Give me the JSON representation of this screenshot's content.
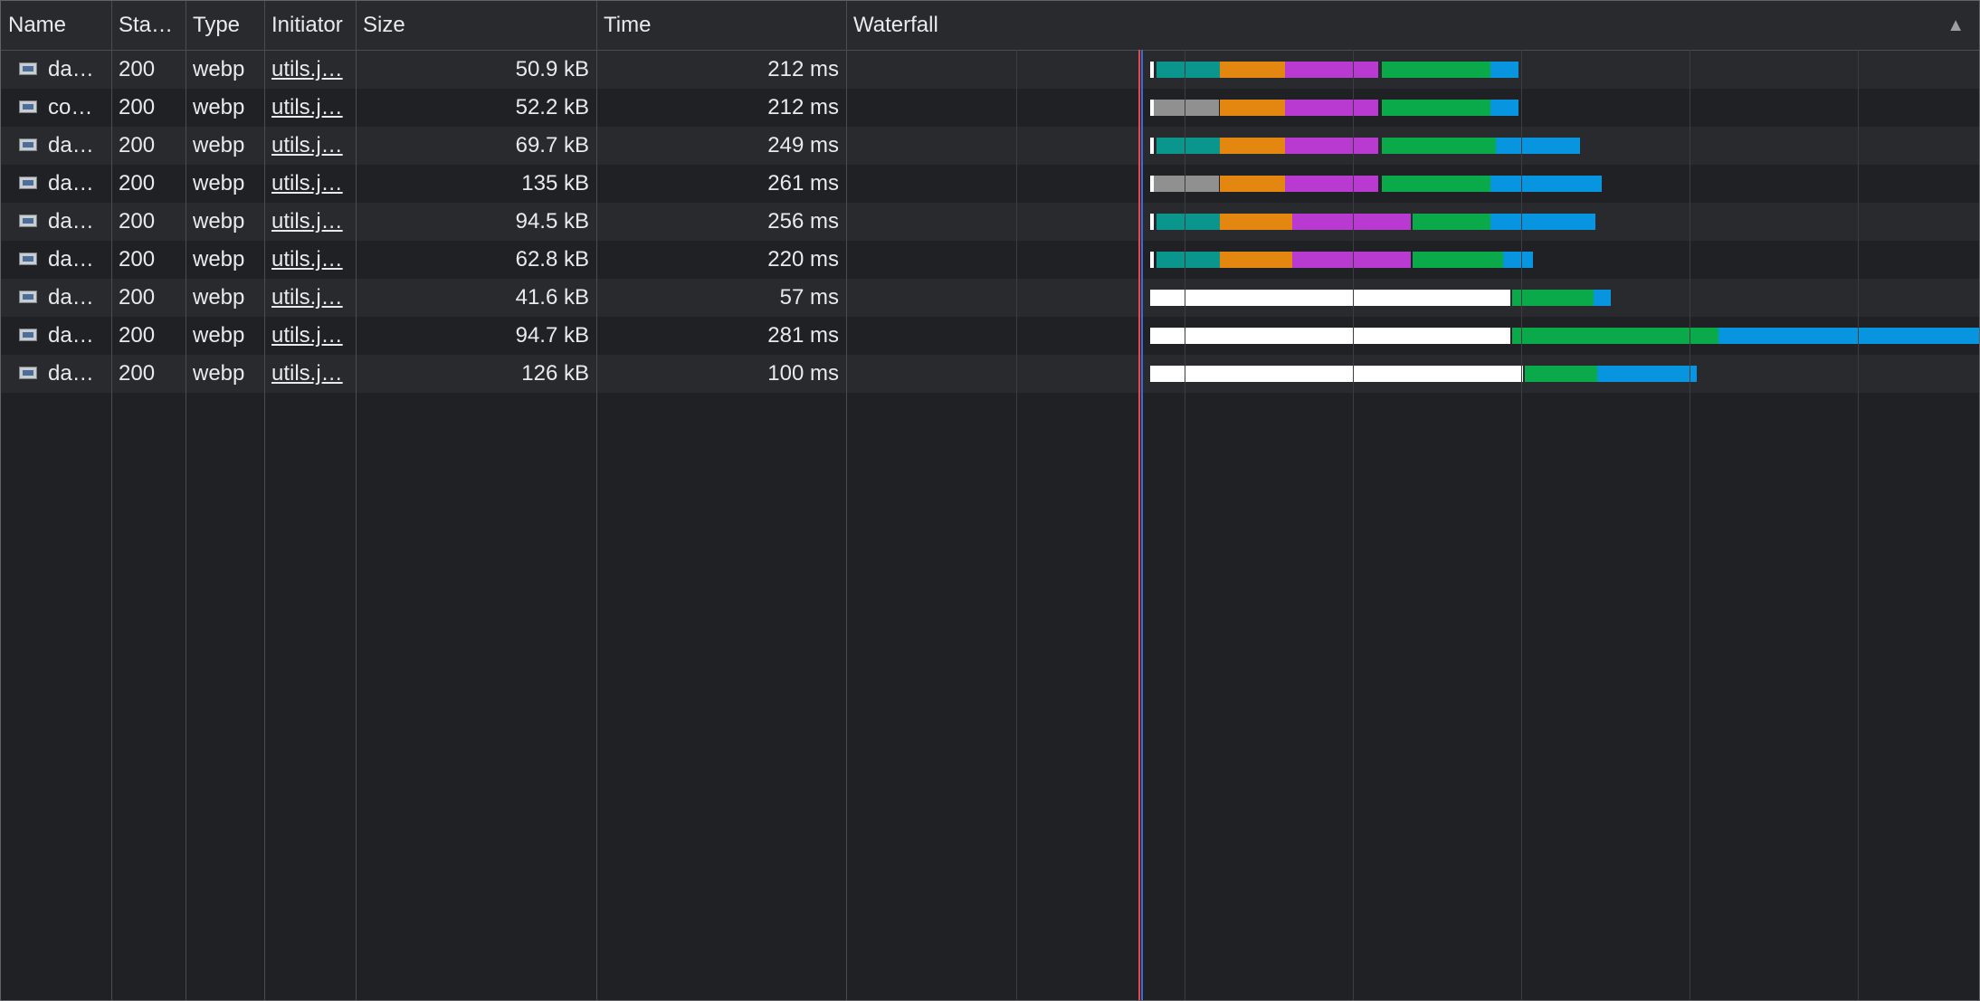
{
  "columns": {
    "name": "Name",
    "status": "Sta…",
    "type": "Type",
    "initiator": "Initiator",
    "size": "Size",
    "time": "Time",
    "waterfall": "Waterfall",
    "sort_icon": "triangle-up-icon"
  },
  "rows": [
    {
      "name": "da…",
      "status": "200",
      "type": "webp",
      "initiator": "utils.j…",
      "size": "50.9 kB",
      "time": "212 ms"
    },
    {
      "name": "co…",
      "status": "200",
      "type": "webp",
      "initiator": "utils.j…",
      "size": "52.2 kB",
      "time": "212 ms"
    },
    {
      "name": "da…",
      "status": "200",
      "type": "webp",
      "initiator": "utils.j…",
      "size": "69.7 kB",
      "time": "249 ms"
    },
    {
      "name": "da…",
      "status": "200",
      "type": "webp",
      "initiator": "utils.j…",
      "size": "135 kB",
      "time": "261 ms"
    },
    {
      "name": "da…",
      "status": "200",
      "type": "webp",
      "initiator": "utils.j…",
      "size": "94.5 kB",
      "time": "256 ms"
    },
    {
      "name": "da…",
      "status": "200",
      "type": "webp",
      "initiator": "utils.j…",
      "size": "62.8 kB",
      "time": "220 ms"
    },
    {
      "name": "da…",
      "status": "200",
      "type": "webp",
      "initiator": "utils.j…",
      "size": "41.6 kB",
      "time": "57 ms"
    },
    {
      "name": "da…",
      "status": "200",
      "type": "webp",
      "initiator": "utils.j…",
      "size": "94.7 kB",
      "time": "281 ms"
    },
    {
      "name": "da…",
      "status": "200",
      "type": "webp",
      "initiator": "utils.j…",
      "size": "126 kB",
      "time": "100 ms"
    }
  ],
  "colors": {
    "queueing": "#ffffff",
    "stalled": "#909090",
    "dns": "#0a958d",
    "connect": "#e48710",
    "ssl": "#b93ad0",
    "waiting": "#0aa94a",
    "download": "#0895e0"
  }
}
